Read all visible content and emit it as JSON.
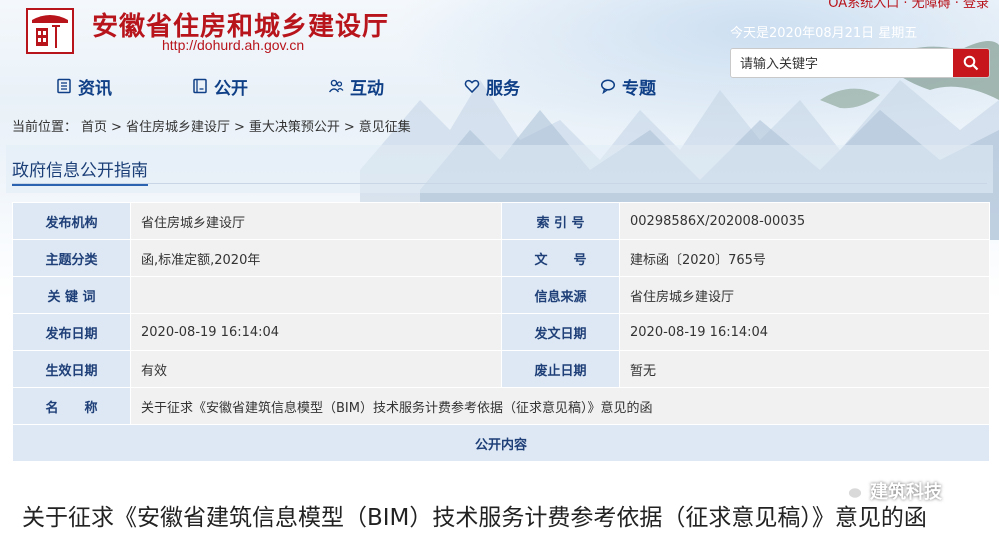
{
  "header": {
    "site_title": "安徽省住房和城乡建设厅",
    "site_url": "http://dohurd.ah.gov.cn",
    "top_links": "OA系统入口 · 无障碍 · 登录",
    "today": "今天是2020年08月21日 星期五"
  },
  "search": {
    "placeholder": "请输入关键字"
  },
  "nav": {
    "items": [
      {
        "label": "资讯",
        "icon": "news-icon"
      },
      {
        "label": "公开",
        "icon": "book-icon"
      },
      {
        "label": "互动",
        "icon": "people-icon"
      },
      {
        "label": "服务",
        "icon": "heart-icon"
      },
      {
        "label": "专题",
        "icon": "chat-bubble-icon"
      }
    ]
  },
  "breadcrumb": {
    "prefix": "当前位置：",
    "items": [
      "首页",
      "省住房城乡建设厅",
      "重大决策预公开",
      "意见征集"
    ],
    "separator": ">"
  },
  "guide": {
    "tab_label": "政府信息公开指南"
  },
  "info_table": {
    "rows": [
      {
        "l1": "发布机构",
        "v1": "省住房城乡建设厅",
        "l2": "索 引 号",
        "v2": "00298586X/202008-00035"
      },
      {
        "l1": "主题分类",
        "v1": "函,标准定额,2020年",
        "l2": "文　　号",
        "v2": "建标函〔2020〕765号"
      },
      {
        "l1": "关 键 词",
        "v1": "",
        "l2": "信息来源",
        "v2": "省住房城乡建设厅"
      },
      {
        "l1": "发布日期",
        "v1": "2020-08-19 16:14:04",
        "l2": "发文日期",
        "v2": "2020-08-19 16:14:04"
      },
      {
        "l1": "生效日期",
        "v1": "有效",
        "l2": "废止日期",
        "v2": "暂无"
      }
    ],
    "name_label": "名　　称",
    "name_value": "关于征求《安徽省建筑信息模型（BIM）技术服务计费参考依据（征求意见稿）》意见的函",
    "content_header": "公开内容"
  },
  "article": {
    "title": "关于征求《安徽省建筑信息模型（BIM）技术服务计费参考依据（征求意见稿）》意见的函"
  },
  "watermark": {
    "label": "建筑科技"
  },
  "colors": {
    "brand_red": "#b8141c",
    "nav_blue": "#0f3f86",
    "label_bg": "#dde8f4",
    "value_bg": "#f1f1f1"
  }
}
